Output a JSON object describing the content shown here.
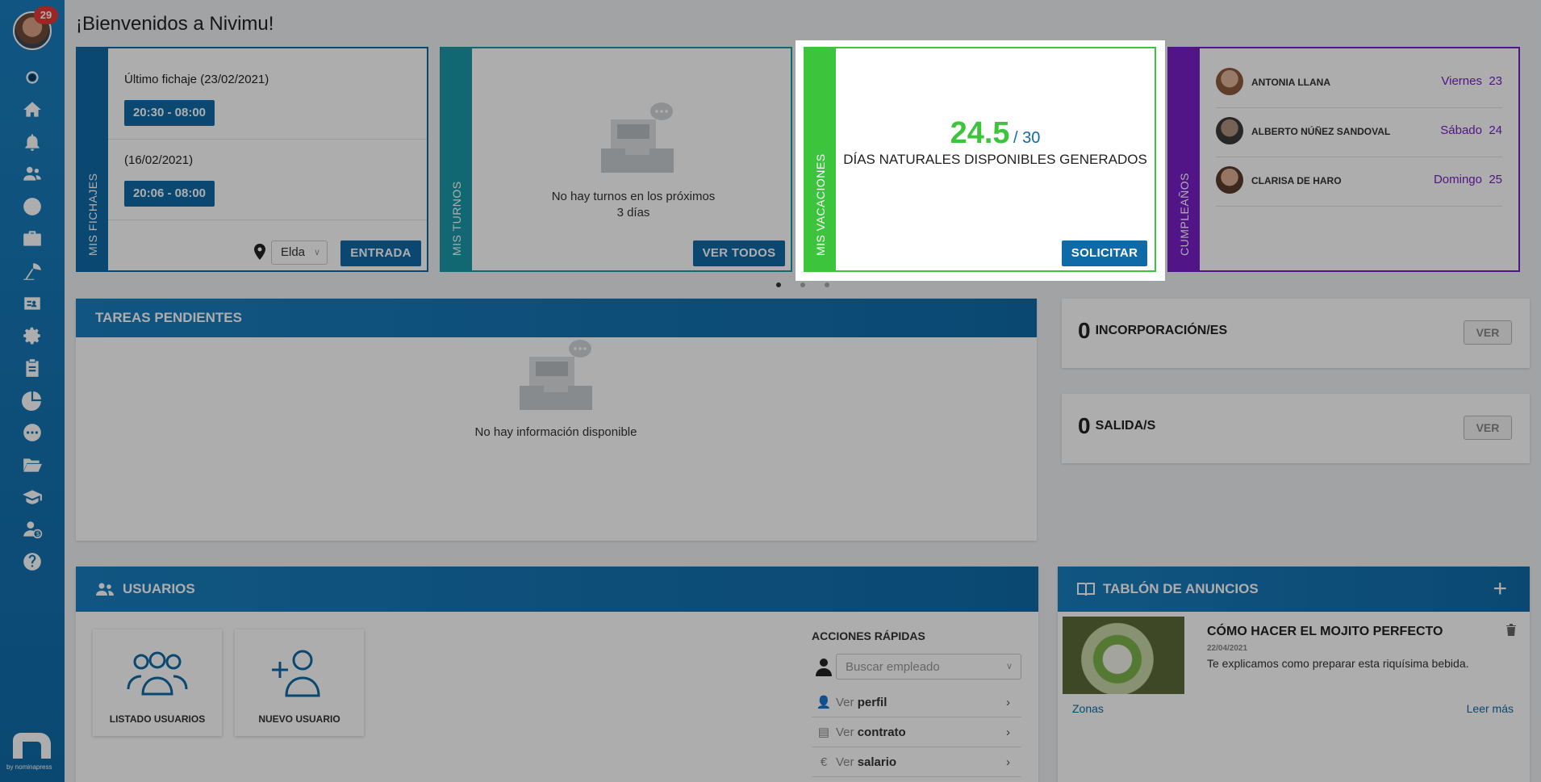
{
  "sidebar": {
    "notification_count": "29",
    "items": [
      "dot-icon",
      "home-icon",
      "bell-icon",
      "users-icon",
      "clock-icon",
      "briefcase-icon",
      "beach-icon",
      "id-card-icon",
      "gear-icon",
      "clipboard-icon",
      "pie-chart-icon",
      "chat-icon",
      "folder-icon",
      "graduation-icon",
      "user-money-icon",
      "help-icon"
    ],
    "by_label": "by nominapress"
  },
  "welcome": "¡Bienvenidos a Nivimu!",
  "fichajes": {
    "strip_label": "MIS FICHAJES",
    "items": [
      {
        "label": "Último fichaje (23/02/2021)",
        "time": "20:30 - 08:00"
      },
      {
        "label": "(16/02/2021)",
        "time": "20:06 - 08:00"
      }
    ],
    "location": "Elda",
    "entrada_label": "ENTRADA"
  },
  "turnos": {
    "strip_label": "MIS TURNOS",
    "empty_line1": "No hay turnos en los próximos",
    "empty_line2": "3 días",
    "ver_todos_label": "VER TODOS"
  },
  "vacaciones": {
    "strip_label": "MIS VACACIONES",
    "available": "24.5",
    "total": "/ 30",
    "description": "DÍAS NATURALES DISPONIBLES GENERADOS",
    "solicitar_label": "SOLICITAR"
  },
  "cumpleanos": {
    "strip_label": "CUMPLEAÑOS",
    "people": [
      {
        "name": "ANTONIA LLANA",
        "day": "Viernes",
        "date": "23"
      },
      {
        "name": "ALBERTO NÚÑEZ SANDOVAL",
        "day": "Sábado",
        "date": "24"
      },
      {
        "name": "CLARISA DE HARO",
        "day": "Domingo",
        "date": "25"
      }
    ]
  },
  "tareas": {
    "title": "TAREAS PENDIENTES",
    "empty": "No hay información disponible"
  },
  "incorporaciones": {
    "count": "0",
    "label": "INCORPORACIÓN/ES",
    "ver": "VER"
  },
  "salidas": {
    "count": "0",
    "label": "SALIDA/S",
    "ver": "VER"
  },
  "usuarios": {
    "title": "USUARIOS",
    "tiles": [
      "LISTADO USUARIOS",
      "NUEVO USUARIO"
    ],
    "quick_actions_title": "ACCIONES RÁPIDAS",
    "search_placeholder": "Buscar empleado",
    "actions": [
      {
        "prefix": "Ver",
        "bold": "perfil"
      },
      {
        "prefix": "Ver",
        "bold": "contrato"
      },
      {
        "prefix": "Ver",
        "bold": "salario"
      }
    ]
  },
  "tablon": {
    "title": "TABLÓN DE ANUNCIOS",
    "post_title": "CÓMO HACER EL MOJITO PERFECTO",
    "post_date": "22/04/2021",
    "post_text": "Te explicamos como preparar esta riquísima bebida.",
    "category": "Zonas",
    "read_more": "Leer más"
  },
  "colors": {
    "primary": "#0f6ba8",
    "turnos": "#1a9aa8",
    "vacaciones": "#3dc43d",
    "cumpleanos": "#7a1fc7"
  }
}
